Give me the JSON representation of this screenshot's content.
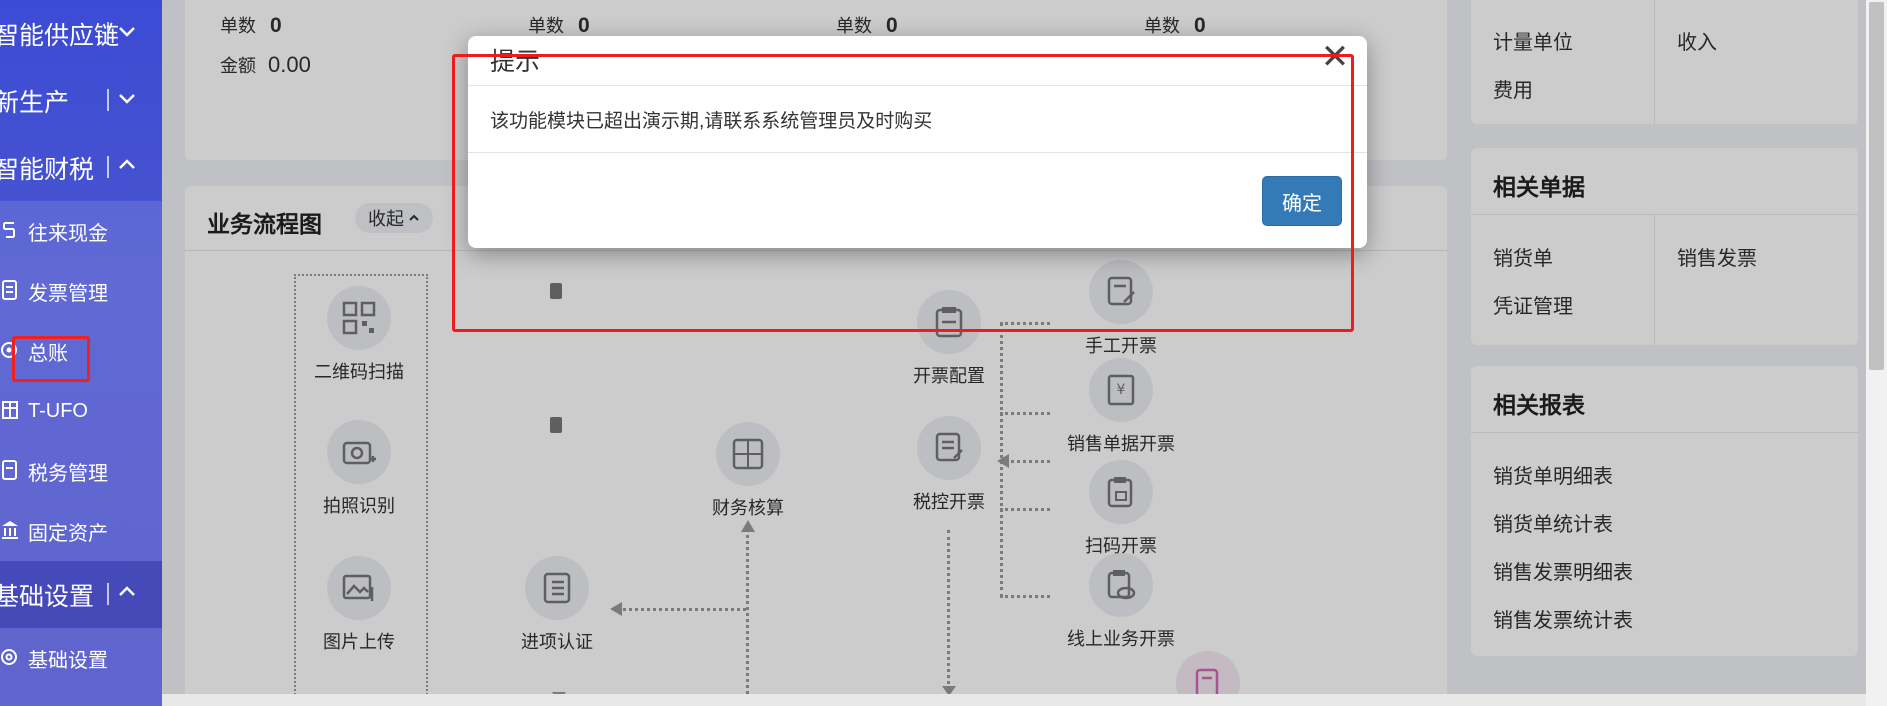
{
  "sidebar": {
    "groups": [
      {
        "label": "智能供应链"
      },
      {
        "label": "新生产"
      },
      {
        "label": "智能财税"
      },
      {
        "label": "基础设置"
      }
    ],
    "finance_items": [
      {
        "label": "往来现金"
      },
      {
        "label": "发票管理"
      },
      {
        "label": "总账"
      },
      {
        "label": "T-UFO"
      },
      {
        "label": "税务管理"
      },
      {
        "label": "固定资产"
      }
    ],
    "basic_items": [
      {
        "label": "基础设置"
      }
    ]
  },
  "stats": {
    "count_label": "单数",
    "count_values": [
      "0",
      "0",
      "0",
      "0"
    ],
    "amount_label": "金额",
    "amount_value": "0.00"
  },
  "flow": {
    "title": "业务流程图",
    "collapse_label": "收起",
    "nodes": {
      "qr_scan": "二维码扫描",
      "photo_ocr": "拍照识别",
      "image_upload": "图片上传",
      "input_verify": "进项认证",
      "finance_accounting": "财务核算",
      "invoice_config": "开票配置",
      "tax_control": "税控开票",
      "manual_invoice": "手工开票",
      "sales_doc_invoice": "销售单据开票",
      "scan_invoice": "扫码开票",
      "online_invoice": "线上业务开票"
    }
  },
  "right_panel": {
    "top_items": [
      "计量单位",
      "收入",
      "费用"
    ],
    "related_docs_title": "相关单据",
    "related_docs": [
      "销货单",
      "销售发票",
      "凭证管理"
    ],
    "related_reports_title": "相关报表",
    "related_reports": [
      "销货单明细表",
      "销货单统计表",
      "销售发票明细表",
      "销售发票统计表"
    ]
  },
  "modal": {
    "title": "提示",
    "close_symbol": "✕",
    "message": "该功能模块已超出演示期,请联系系统管理员及时购买",
    "ok_label": "确定"
  },
  "colors": {
    "sidebar_bg": "#3b4bd4",
    "primary_button": "#337ab7",
    "highlight_red": "#ee1c1c"
  }
}
